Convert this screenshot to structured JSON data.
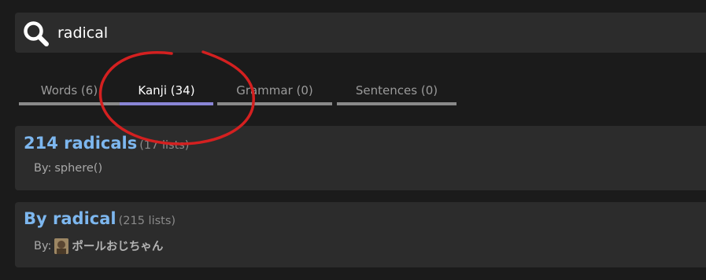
{
  "search": {
    "value": "radical",
    "icon": "search-icon"
  },
  "tabs": [
    {
      "label": "Words (6)",
      "active": false
    },
    {
      "label": "Kanji (34)",
      "active": true
    },
    {
      "label": "Grammar (0)",
      "active": false
    },
    {
      "label": "Sentences (0)",
      "active": false
    }
  ],
  "results": [
    {
      "title": "214 radicals",
      "count": "(17 lists)",
      "by_label": "By:",
      "author": "sphere()",
      "avatar": false
    },
    {
      "title": "By radical",
      "count": "(215 lists)",
      "by_label": "By:",
      "author": "ポールおじちゃん",
      "avatar": true
    }
  ],
  "colors": {
    "accent_tab": "#8a86d6",
    "link": "#7db7ef",
    "annotation": "#d42020"
  }
}
